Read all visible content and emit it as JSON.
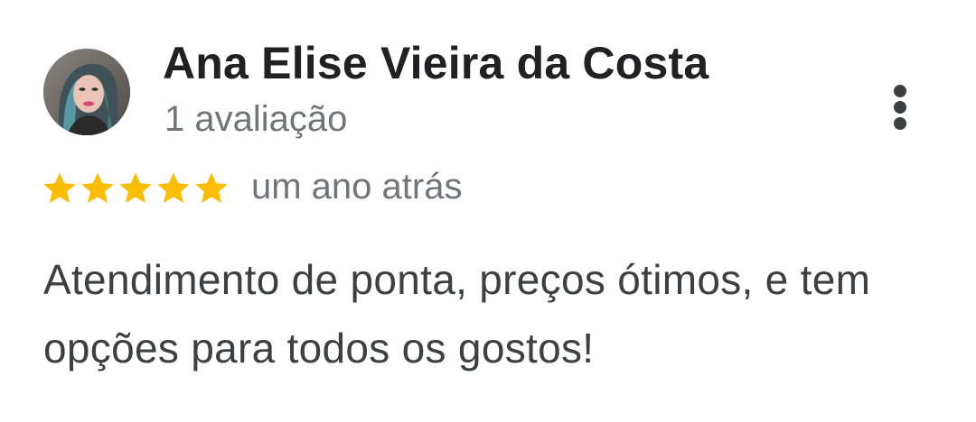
{
  "review": {
    "reviewer_name": "Ana Elise Vieira da Costa",
    "review_count": "1 avaliação",
    "rating": 5,
    "rating_max": 5,
    "date": "um ano atrás",
    "text": "Atendimento de ponta, preços ótimos, e tem opções para todos os gostos!"
  },
  "icons": {
    "avatar": "user-photo",
    "more": "more-vertical-icon",
    "star": "star-icon"
  },
  "colors": {
    "star": "#fbbc04",
    "name": "#202124",
    "secondary_text": "#70757a",
    "body_text": "#3c4043"
  }
}
